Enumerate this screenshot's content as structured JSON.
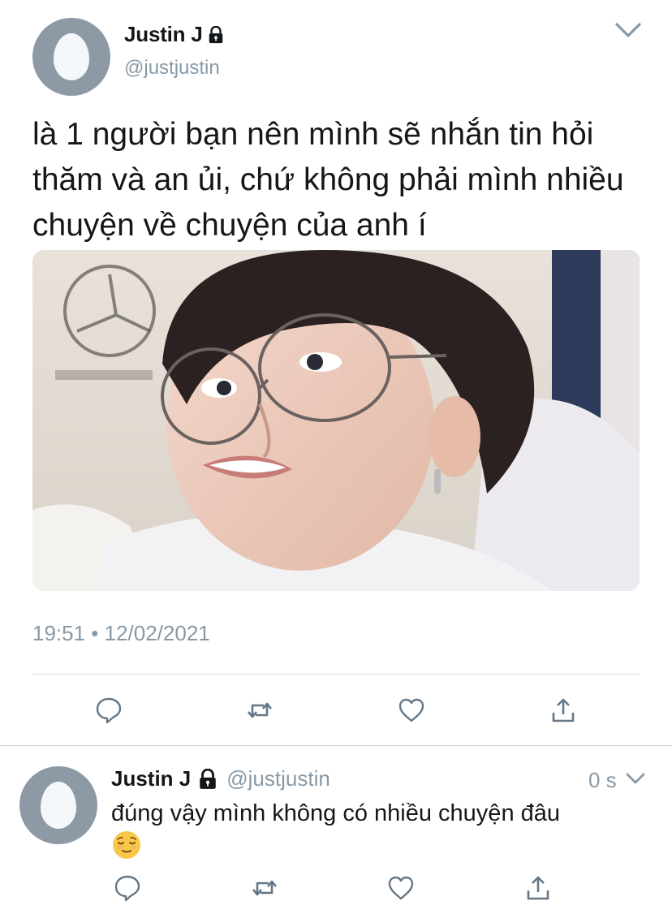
{
  "tweet": {
    "display_name": "Justin J",
    "handle": "@justjustin",
    "text": "là 1 người bạn nên mình sẽ nhắn tin hỏi thăm và an ủi, chứ không phải mình nhiều chuyện về chuyện của anh í",
    "timestamp": "19:51 • 12/02/2021",
    "media_description": "photo",
    "icons": {
      "lock": "lock-icon",
      "more": "chevron-down-icon",
      "reply": "reply-icon",
      "retweet": "retweet-icon",
      "like": "heart-icon",
      "share": "share-icon"
    }
  },
  "reply": {
    "display_name": "Justin J",
    "handle": "@justjustin",
    "time": "0 s",
    "text": "đúng vậy mình không có nhiều chuyện đâu",
    "emoji": "relieved-face"
  },
  "colors": {
    "text": "#14171a",
    "secondary": "#8899a6",
    "avatar_bg": "#8d9aa6",
    "divider": "#d5dbe0"
  }
}
